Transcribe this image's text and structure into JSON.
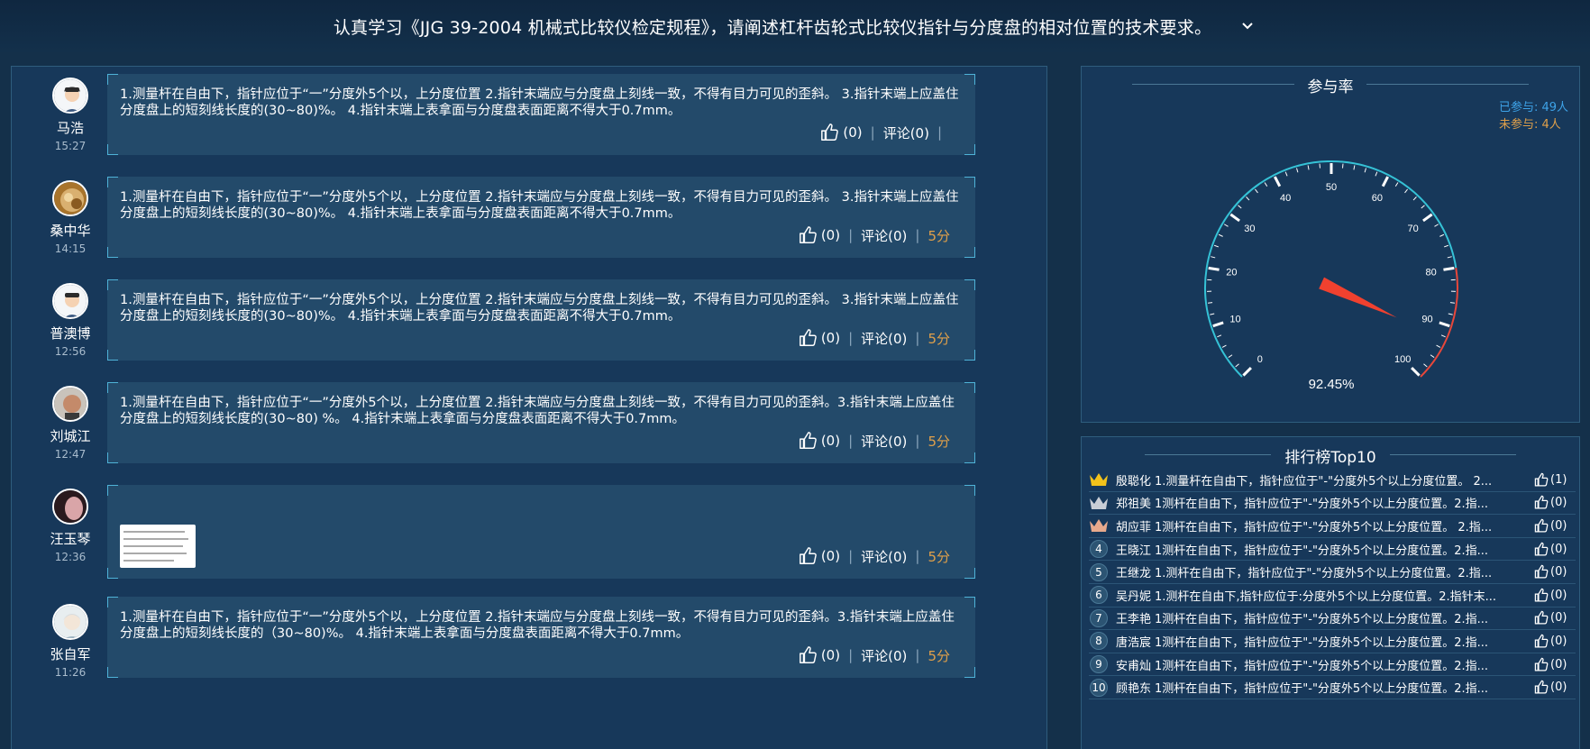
{
  "header": {
    "question": "认真学习《JJG 39-2004 机械式比较仪检定规程》，请阐述杠杆齿轮式比较仪指针与分度盘的相对位置的技术要求。",
    "expand_icon": "chevron-down-icon"
  },
  "answers": [
    {
      "name": "马浩",
      "time": "15:27",
      "text": "1.测量杆在自由下，指针应位于“一”分度外5个以，上分度位置 2.指针末端应与分度盘上刻线一致，不得有目力可见的歪斜。 3.指针末端上应盖住分度盘上的短刻线长度的(30~80)%。 4.指针末端上表拿面与分度盘表面距离不得大于0.7mm。",
      "likes": "(0)",
      "comment": "评论(0)",
      "score": ""
    },
    {
      "name": "桑中华",
      "time": "14:15",
      "text": "1.测量杆在自由下，指针应位于“一”分度外5个以，上分度位置 2.指针末端应与分度盘上刻线一致，不得有目力可见的歪斜。 3.指针末端上应盖住分度盘上的短刻线长度的(30~80)%。 4.指针末端上表拿面与分度盘表面距离不得大于0.7mm。",
      "likes": "(0)",
      "comment": "评论(0)",
      "score": "5分"
    },
    {
      "name": "普澳博",
      "time": "12:56",
      "text": "1.测量杆在自由下，指针应位于“一”分度外5个以，上分度位置 2.指针末端应与分度盘上刻线一致，不得有目力可见的歪斜。 3.指针末端上应盖住分度盘上的短刻线长度的(30~80)%。 4.指针末端上表拿面与分度盘表面距离不得大于0.7mm。",
      "likes": "(0)",
      "comment": "评论(0)",
      "score": "5分"
    },
    {
      "name": "刘城江",
      "time": "12:47",
      "text": "1.测量杆在自由下，指针应位于“一”分度外5个以，上分度位置 2.指针末端应与分度盘上刻线一致，不得有目力可见的歪斜。3.指针末端上应盖住分度盘上的短刻线长度的(30~80) %。 4.指针末端上表拿面与分度盘表面距离不得大于0.7mm。",
      "likes": "(0)",
      "comment": "评论(0)",
      "score": "5分"
    },
    {
      "name": "汪玉琴",
      "time": "12:36",
      "text": "",
      "likes": "(0)",
      "comment": "评论(0)",
      "score": "5分"
    },
    {
      "name": "张自军",
      "time": "11:26",
      "text": "1.测量杆在自由下，指针应位于“一”分度外5个以，上分度位置 2.指针末端应与分度盘上刻线一致，不得有目力可见的歪斜。3.指针末端上应盖住分度盘上的短刻线长度的（30~80)%。 4.指针末端上表拿面与分度盘表面距离不得大于0.7mm。",
      "likes": "(0)",
      "comment": "评论(0)",
      "score": "5分"
    }
  ],
  "participation": {
    "title": "参与率",
    "joined": "已参与: 49人",
    "not_joined": "未参与: 4人",
    "percent_label": "92.45%",
    "value": 92.45,
    "scale_min": 0,
    "scale_max": 100,
    "tick_labels": [
      "0",
      "10",
      "20",
      "30",
      "40",
      "50",
      "60",
      "70",
      "80",
      "90",
      "100"
    ],
    "colors": {
      "arc": "#35c2d6",
      "danger": "#e8473a",
      "needle": "#f0412f"
    }
  },
  "ranking": {
    "title": "排行榜Top10",
    "rows": [
      {
        "rank": "1",
        "name": "殷聪化",
        "text": "1.测量杆在自由下，指针应位于\"-\"分度外5个以上分度位置。 2...",
        "likes": "(1)"
      },
      {
        "rank": "2",
        "name": "郑祖美",
        "text": "1测杆在自由下，指针应位于\"-\"分度外5个以上分度位置。2.指...",
        "likes": "(0)"
      },
      {
        "rank": "3",
        "name": "胡应菲",
        "text": "1测杆在自由下，指针应位于\"-\"分度外5个以上分度位置。 2.指...",
        "likes": "(0)"
      },
      {
        "rank": "4",
        "name": "王晓江",
        "text": "1测杆在自由下，指针应位于\"-\"分度外5个以上分度位置。2.指...",
        "likes": "(0)"
      },
      {
        "rank": "5",
        "name": "王继龙",
        "text": "1.测杆在自由下，指针应位于\"-\"分度外5个以上分度位置。2.指...",
        "likes": "(0)"
      },
      {
        "rank": "6",
        "name": "吴丹妮",
        "text": "1.测杆在自由下,指针应位于:分度外5个以上分度位置。2.指针末...",
        "likes": "(0)"
      },
      {
        "rank": "7",
        "name": "王李艳",
        "text": "1测杆在自由下，指针应位于\"-\"分度外5个以上分度位置。2.指...",
        "likes": "(0)"
      },
      {
        "rank": "8",
        "name": "唐浩宸",
        "text": "1测杆在自由下，指针应位于\"-\"分度外5个以上分度位置。2.指...",
        "likes": "(0)"
      },
      {
        "rank": "9",
        "name": "安甫灿",
        "text": "1测杆在自由下，指针应位于\"-\"分度外5个以上分度位置。2.指...",
        "likes": "(0)"
      },
      {
        "rank": "10",
        "name": "顾艳东",
        "text": "1测杆在自由下，指针应位于\"-\"分度外5个以上分度位置。2.指...",
        "likes": "(0)"
      }
    ]
  }
}
